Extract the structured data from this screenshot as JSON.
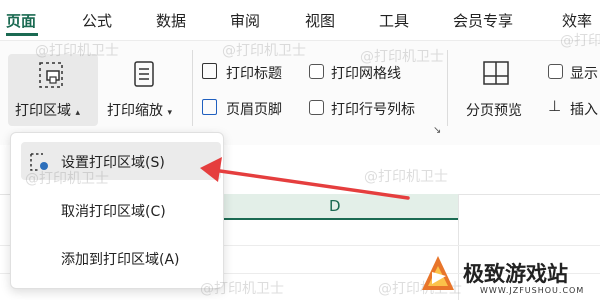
{
  "menu": {
    "items": [
      {
        "label": "页面",
        "active": true
      },
      {
        "label": "公式"
      },
      {
        "label": "数据"
      },
      {
        "label": "审阅"
      },
      {
        "label": "视图"
      },
      {
        "label": "工具"
      },
      {
        "label": "会员专享"
      },
      {
        "label": "效率"
      }
    ]
  },
  "ribbon": {
    "print_area_label": "打印区域",
    "print_scale_label": "打印缩放",
    "print_titles_label": "打印标题",
    "header_footer_label": "页眉页脚",
    "print_gridlines_label": "打印网格线",
    "print_row_col_label": "打印行号列标",
    "page_break_preview_label": "分页预览",
    "show_label": "显示",
    "insert_label": "插入"
  },
  "dropdown": {
    "items": [
      {
        "label": "设置打印区域(S)"
      },
      {
        "label": "取消打印区域(C)"
      },
      {
        "label": "添加到打印区域(A)"
      }
    ]
  },
  "sheet": {
    "column_d": "D"
  },
  "watermark": {
    "text": "@打印机卫士"
  },
  "logo": {
    "name": "极致游戏站",
    "url": "WWW.JZFUSHOU.COM"
  },
  "colors": {
    "accent": "#1b6a52",
    "arrow": "#e53e3e"
  }
}
